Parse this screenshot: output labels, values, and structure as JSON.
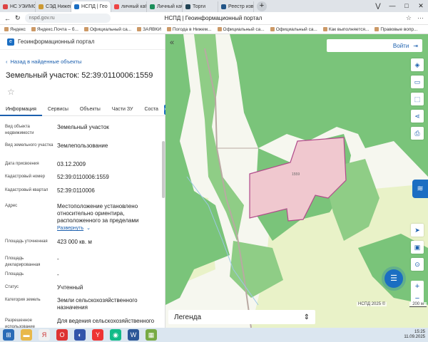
{
  "tabs": [
    {
      "label": "НС УЭИМО",
      "color": "#d44"
    },
    {
      "label": "СЭД Нижего",
      "color": "#c93"
    },
    {
      "label": "НСПД | Гео",
      "color": "#1b6ec2",
      "active": true
    },
    {
      "label": "личный кабин",
      "color": "#e44"
    },
    {
      "label": "Личный кабин",
      "color": "#1b8e5a"
    },
    {
      "label": "Торги",
      "color": "#245"
    },
    {
      "label": "Реестр извеще",
      "color": "#258"
    }
  ],
  "browser": {
    "url": "nspd.gov.ru",
    "page_title": "НСПД | Геоинформационный портал",
    "new_tab": "+",
    "win": [
      "⋁",
      "—",
      "□",
      "✕"
    ],
    "addr_icons": [
      "☆",
      "⋯"
    ]
  },
  "bookmarks": [
    "Яндекс",
    "Яндекс.Почта – б...",
    "Официальный са...",
    "ЗАЯВКИ",
    "Погода в Нижем...",
    "Официальный са...",
    "Официальный са...",
    "Как выполняется...",
    "Правовые вопр..."
  ],
  "panel": {
    "portal": "Геоинформационный портал",
    "back": "Назад в найденные объекты",
    "title": "Земельный участок: 52:39:0110006:1559",
    "tabs": [
      "Информация",
      "Сервисы",
      "Объекты",
      "Части ЗУ",
      "Соста"
    ],
    "more": "»",
    "rows": [
      {
        "k": "Вид объекта недвижимости",
        "v": "Земельный участок"
      },
      {
        "k": "Вид земельного участка",
        "v": "Землепользование"
      },
      {
        "k": "Дата присвоения",
        "v": "03.12.2009"
      },
      {
        "k": "Кадастровый номер",
        "v": "52:39:0110006:1559"
      },
      {
        "k": "Кадастровый квартал",
        "v": "52:39:0110006"
      },
      {
        "k": "Адрес",
        "v": "Местоположение установлено относительно ориентира, расположенного за пределами"
      },
      {
        "k": "Площадь уточненная",
        "v": "423 000 кв. м"
      },
      {
        "k": "Площадь декларированная",
        "v": "-"
      },
      {
        "k": "Площадь",
        "v": "-"
      },
      {
        "k": "Статус",
        "v": "Учтенный"
      },
      {
        "k": "Категория земель",
        "v": "Земли сельскохозяйственного назначения"
      },
      {
        "k": "Разрешенное использование",
        "v": "Для ведения сельскохозяйственного"
      }
    ],
    "expand": "Развернуть"
  },
  "map": {
    "login": "Войти",
    "legend": "Легенда",
    "attribution": "НСПД 2025 ©",
    "scale": "200 м",
    "parcel_label": "1559",
    "colors": {
      "forest": "#7ac47a",
      "meadow": "#e9f2c8",
      "parcel": "#f0c8cf",
      "parcel_edge": "#b04a8a",
      "road": "#b9a9a2",
      "accent": "#1b6ec2"
    }
  },
  "clock": {
    "time": "15:25",
    "date": "11.09.2025"
  }
}
